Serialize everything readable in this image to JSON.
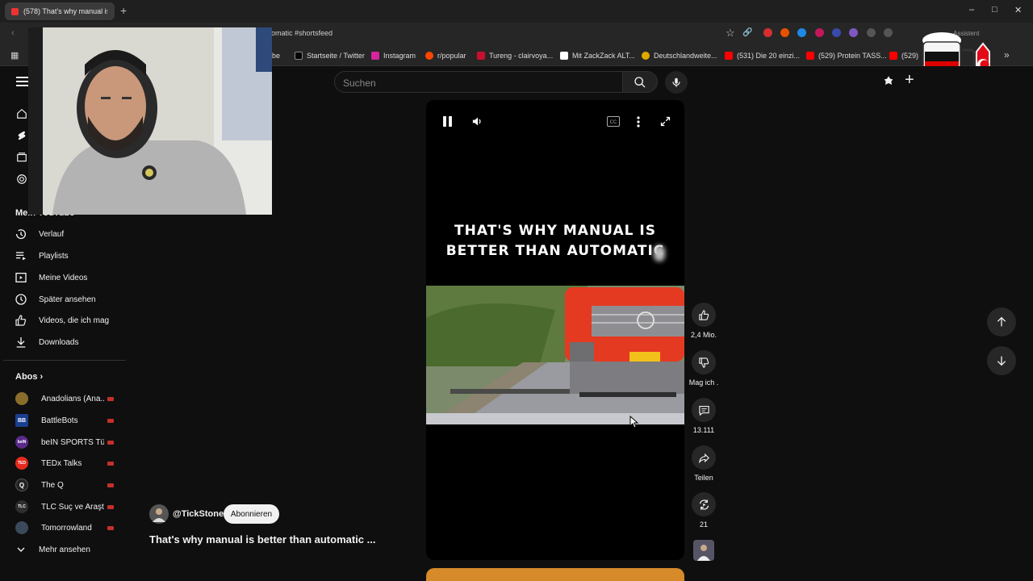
{
  "browser": {
    "tab_title": "(578) That's why manual is be",
    "new_tab": "+",
    "url_fragment": "omatic #shortsfeed",
    "assistant_label": "Assistent",
    "bookmarks": [
      {
        "label": "be",
        "color": "#ff0000"
      },
      {
        "label": "Startseite / Twitter",
        "color": "#000000"
      },
      {
        "label": "Instagram",
        "color": "#d6249f"
      },
      {
        "label": "r/popular",
        "color": "#ff4500"
      },
      {
        "label": "Tureng - clairvoya...",
        "color": "#c8102e"
      },
      {
        "label": "Mit ZackZack ALT...",
        "color": "#d61f26"
      },
      {
        "label": "Deutschlandweite...",
        "color": "#e0a800"
      },
      {
        "label": "(531) Die 20 einzi...",
        "color": "#ff0000"
      },
      {
        "label": "(529) Protein TASS...",
        "color": "#ff0000"
      },
      {
        "label": "(529)",
        "color": "#ff0000"
      }
    ]
  },
  "search": {
    "placeholder": "Suchen"
  },
  "sidebar": {
    "you_label": "Mein YouTube",
    "you_items": [
      {
        "label": "Verlauf",
        "icon": "history-icon"
      },
      {
        "label": "Playlists",
        "icon": "playlist-icon"
      },
      {
        "label": "Meine Videos",
        "icon": "my-videos-icon"
      },
      {
        "label": "Später ansehen",
        "icon": "watch-later-icon"
      },
      {
        "label": "Videos, die ich mag",
        "icon": "liked-icon"
      },
      {
        "label": "Downloads",
        "icon": "download-icon"
      }
    ],
    "subs_label": "Abos",
    "subscriptions": [
      {
        "name": "Anadolians (Ana...",
        "avatar_color": "#8a6d2b",
        "initials": ""
      },
      {
        "name": "BattleBots",
        "avatar_color": "#1a3f8f",
        "initials": "BB"
      },
      {
        "name": "beIN SPORTS Tü...",
        "avatar_color": "#5a2a8a",
        "initials": "beIN"
      },
      {
        "name": "TEDx Talks",
        "avatar_color": "#e62b1e",
        "initials": "TED"
      },
      {
        "name": "The Q",
        "avatar_color": "#222222",
        "initials": "Q"
      },
      {
        "name": "TLC Suç ve Araşt...",
        "avatar_color": "#2e2e2e",
        "initials": "TLC"
      },
      {
        "name": "Tomorrowland",
        "avatar_color": "#3a4a5a",
        "initials": ""
      }
    ],
    "more_label": "Mehr ansehen"
  },
  "short": {
    "headline": "THAT'S WHY MANUAL IS\nBETTER THAN AUTOMATIC",
    "channel": "@TickStone",
    "subscribe_label": "Abonnieren",
    "title": "That's why manual is better than automatic ..."
  },
  "actions": {
    "like_count": "2,4 Mio.",
    "dislike_label": "Mag ich .",
    "comment_count": "13.111",
    "share_label": "Teilen",
    "remix_count": "21"
  },
  "colors": {
    "accent_red": "#ff0000",
    "live_red": "#c4302b"
  }
}
